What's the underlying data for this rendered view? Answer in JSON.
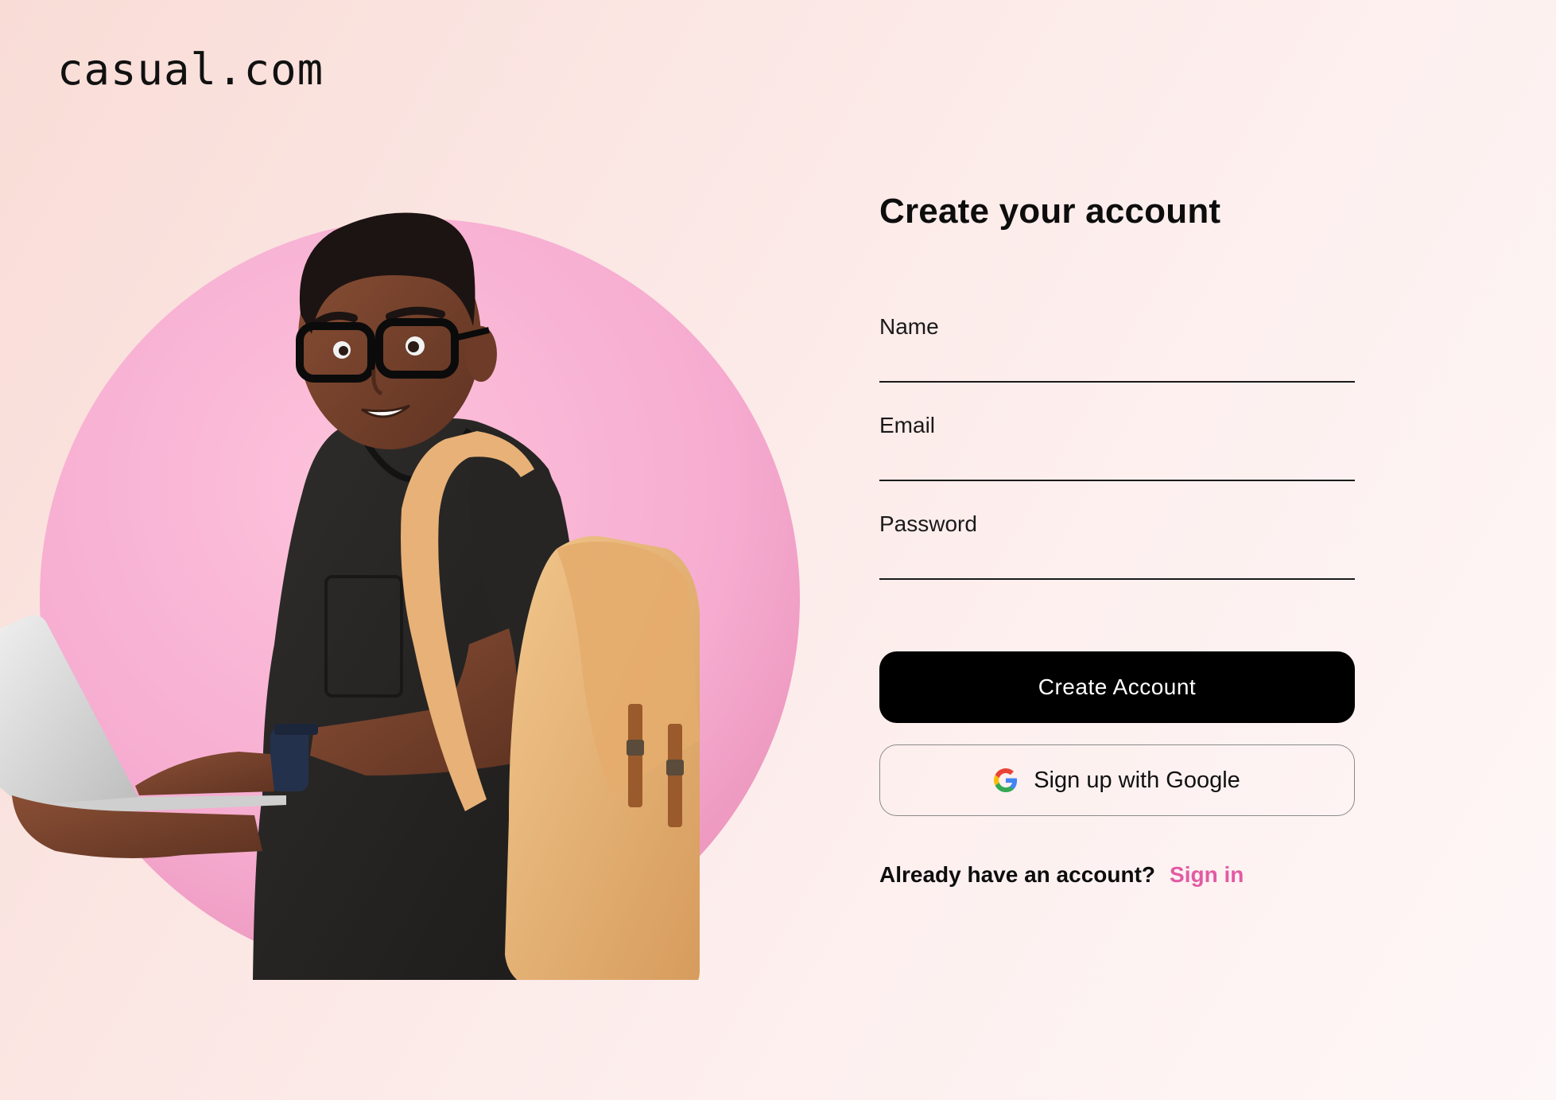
{
  "brand": {
    "logo_text": "casual.com"
  },
  "form": {
    "title": "Create your account",
    "fields": [
      {
        "label": "Name",
        "value": "",
        "placeholder": ""
      },
      {
        "label": "Email",
        "value": "",
        "placeholder": ""
      },
      {
        "label": "Password",
        "value": "",
        "placeholder": ""
      }
    ],
    "primary_button": "Create Account",
    "google_button": "Sign up with Google",
    "signin_prompt": "Already have an account?",
    "signin_link": "Sign in"
  },
  "colors": {
    "accent_pink": "#e35aa3",
    "circle_pink": "#f6a9cc",
    "button_black": "#000000"
  },
  "illustration": {
    "subject": "person-with-laptop-and-backpack"
  }
}
